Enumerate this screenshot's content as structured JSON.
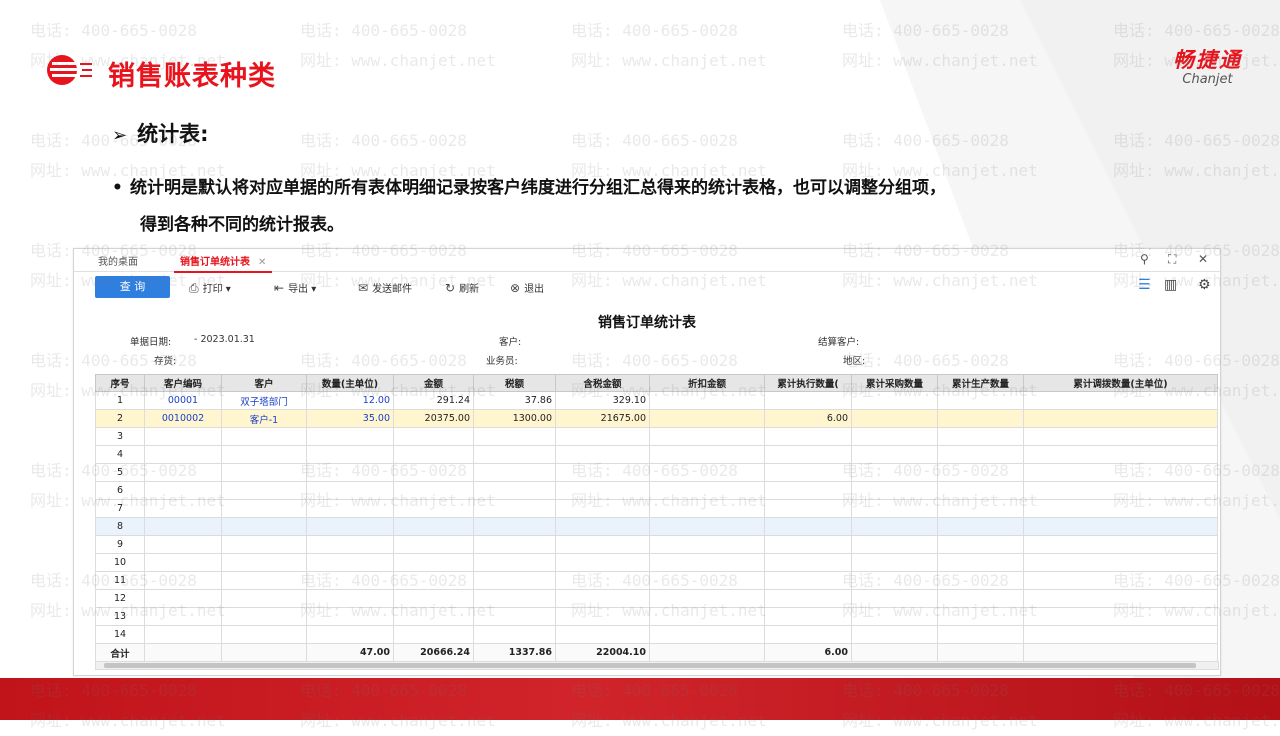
{
  "slide": {
    "title": "销售账表种类",
    "sub_heading": "统计表:",
    "bullet_line1": "统计明是默认将对应单据的所有表体明细记录按客户纬度进行分组汇总得来的统计表格，也可以调整分组项，",
    "bullet_line2": "得到各种不同的统计报表。",
    "brand_cn": "畅捷通",
    "brand_en": "Chanjet",
    "watermark_phone": "电话: 400-665-0028",
    "watermark_site": "网址: www.chanjet.net",
    "accent_color": "#e8141d"
  },
  "app": {
    "tabs": {
      "home": "我的桌面",
      "active": "销售订单统计表",
      "close": "✕"
    },
    "window_controls": [
      "search-icon",
      "maximize-icon",
      "close-icon"
    ],
    "toolbar": {
      "query": "查 询",
      "print": "打印",
      "export": "导出",
      "email": "发送邮件",
      "refresh": "刷新",
      "exit": "退出"
    },
    "report_title": "销售订单统计表",
    "filters": {
      "doc_date_label": "单据日期:",
      "doc_date_value": "- 2023.01.31",
      "customer_label": "客户:",
      "settle_customer_label": "结算客户:",
      "stock_label": "存货:",
      "salesman_label": "业务员:",
      "region_label": "地区:"
    },
    "columns": [
      "序号",
      "客户编码",
      "客户",
      "数量(主单位)",
      "金额",
      "税额",
      "含税金额",
      "折扣金额",
      "累计执行数量(",
      "累计采购数量",
      "累计生产数量",
      "累计调拨数量(主单位)"
    ],
    "rows": [
      [
        "1",
        "00001",
        "双子塔部门",
        "12.00",
        "291.24",
        "37.86",
        "329.10",
        "",
        "",
        "",
        "",
        ""
      ],
      [
        "2",
        "0010002",
        "客户-1",
        "35.00",
        "20375.00",
        "1300.00",
        "21675.00",
        "",
        "6.00",
        "",
        "",
        ""
      ],
      [
        "3",
        "",
        "",
        "",
        "",
        "",
        "",
        "",
        "",
        "",
        "",
        ""
      ],
      [
        "4",
        "",
        "",
        "",
        "",
        "",
        "",
        "",
        "",
        "",
        "",
        ""
      ],
      [
        "5",
        "",
        "",
        "",
        "",
        "",
        "",
        "",
        "",
        "",
        "",
        ""
      ],
      [
        "6",
        "",
        "",
        "",
        "",
        "",
        "",
        "",
        "",
        "",
        "",
        ""
      ],
      [
        "7",
        "",
        "",
        "",
        "",
        "",
        "",
        "",
        "",
        "",
        "",
        ""
      ],
      [
        "8",
        "",
        "",
        "",
        "",
        "",
        "",
        "",
        "",
        "",
        "",
        ""
      ],
      [
        "9",
        "",
        "",
        "",
        "",
        "",
        "",
        "",
        "",
        "",
        "",
        ""
      ],
      [
        "10",
        "",
        "",
        "",
        "",
        "",
        "",
        "",
        "",
        "",
        "",
        ""
      ],
      [
        "11",
        "",
        "",
        "",
        "",
        "",
        "",
        "",
        "",
        "",
        "",
        ""
      ],
      [
        "12",
        "",
        "",
        "",
        "",
        "",
        "",
        "",
        "",
        "",
        "",
        ""
      ],
      [
        "13",
        "",
        "",
        "",
        "",
        "",
        "",
        "",
        "",
        "",
        "",
        ""
      ],
      [
        "14",
        "",
        "",
        "",
        "",
        "",
        "",
        "",
        "",
        "",
        "",
        ""
      ]
    ],
    "total_row": [
      "合计",
      "",
      "",
      "47.00",
      "20666.24",
      "1337.86",
      "22004.10",
      "",
      "6.00",
      "",
      "",
      ""
    ]
  }
}
